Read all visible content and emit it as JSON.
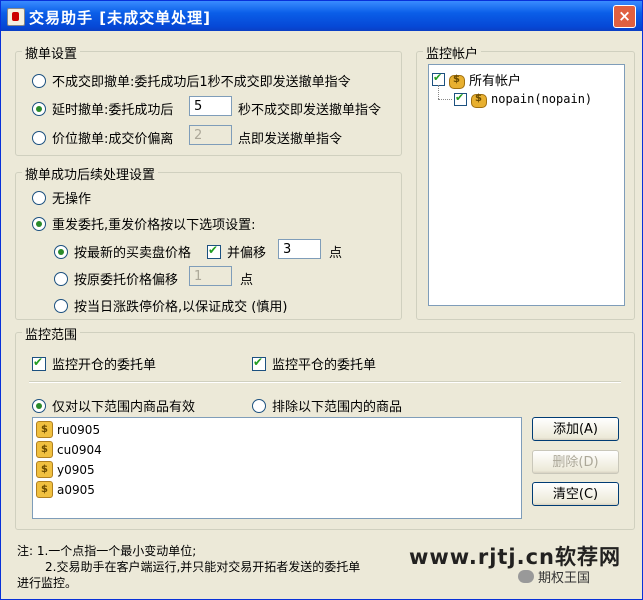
{
  "window": {
    "title": "交易助手 [未成交单处理]",
    "close_label": "×"
  },
  "cancel_settings": {
    "legend": "撤单设置",
    "opt_immediate": "不成交即撤单:委托成功后1秒不成交即发送撤单指令",
    "opt_delay_prefix": "延时撤单:委托成功后",
    "delay_value": "5",
    "opt_delay_suffix": "秒不成交即发送撤单指令",
    "opt_price_prefix": "价位撤单:成交价偏离",
    "price_value": "2",
    "opt_price_suffix": "点即发送撤单指令"
  },
  "after_cancel": {
    "legend": "撤单成功后续处理设置",
    "opt_none": "无操作",
    "opt_resend": "重发委托,重发价格按以下选项设置:",
    "sub_latest": "按最新的买卖盘价格",
    "sub_offset_check": "并偏移",
    "offset_value": "3",
    "offset_unit": "点",
    "sub_original": "按原委托价格偏移",
    "original_value": "1",
    "original_unit": "点",
    "sub_limit": "按当日涨跌停价格,以保证成交 (慎用)"
  },
  "accounts": {
    "legend": "监控帐户",
    "all": "所有帐户",
    "child": "nopain(nopain)"
  },
  "scope": {
    "legend": "监控范围",
    "chk_open": "监控开仓的委托单",
    "chk_close": "监控平仓的委托单",
    "opt_include": "仅对以下范围内商品有效",
    "opt_exclude": "排除以下范围内的商品",
    "items": [
      "ru0905",
      "cu0904",
      "y0905",
      "a0905"
    ],
    "item_icon": "$",
    "btn_add": "添加(A)",
    "btn_delete": "删除(D)",
    "btn_clear": "清空(C)"
  },
  "notes": {
    "line1": "注: 1.一个点指一个最小变动单位;",
    "line2": "2.交易助手在客户端运行,并只能对交易开拓者发送的委托单",
    "line3": "进行监控。"
  },
  "watermark": {
    "site": "www.rjtj.cn软荐网",
    "sub": "期权王国"
  }
}
